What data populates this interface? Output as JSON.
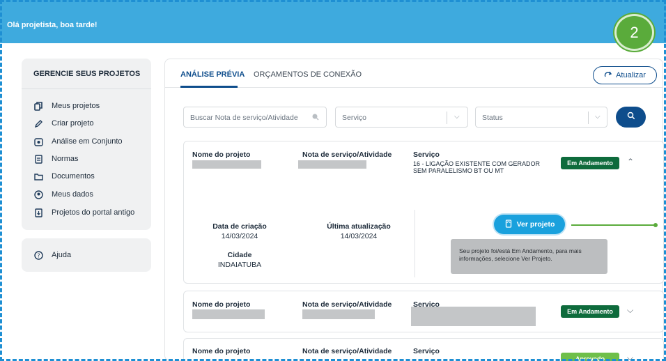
{
  "header": {
    "greeting": "Olá projetista, boa tarde!",
    "step_number": "2"
  },
  "sidebar": {
    "title": "GERENCIE SEUS PROJETOS",
    "items": [
      {
        "label": "Meus projetos",
        "icon": "copy-icon"
      },
      {
        "label": "Criar projeto",
        "icon": "pencil-icon"
      },
      {
        "label": "Análise em Conjunto",
        "icon": "shared-docs-icon"
      },
      {
        "label": "Normas",
        "icon": "document-icon"
      },
      {
        "label": "Documentos",
        "icon": "folder-icon"
      },
      {
        "label": "Meus dados",
        "icon": "user-icon"
      },
      {
        "label": "Projetos do portal antigo",
        "icon": "archive-icon"
      }
    ],
    "help": {
      "label": "Ajuda",
      "icon": "question-icon"
    }
  },
  "tabs": [
    {
      "label": "ANÁLISE PRÉVIA",
      "active": true
    },
    {
      "label": "ORÇAMENTOS DE CONEXÃO",
      "active": false
    }
  ],
  "refresh_label": "Atualizar",
  "filters": {
    "search_placeholder": "Buscar Nota de serviço/Atividade",
    "service_placeholder": "Serviço",
    "status_placeholder": "Status"
  },
  "columns": {
    "project_name": "Nome do projeto",
    "service_note": "Nota de serviço/Atividade",
    "service": "Serviço"
  },
  "projects": [
    {
      "service_text": "16 - LIGAÇÃO EXISTENTE COM GERADOR SEM PARALELISMO BT OU MT",
      "status": "Em Andamento",
      "expanded": true,
      "details": {
        "created_label": "Data de criação",
        "created_value": "14/03/2024",
        "updated_label": "Última atualização",
        "updated_value": "14/03/2024",
        "city_label": "Cidade",
        "city_value": "INDAIATUBA",
        "view_button": "Ver projeto",
        "tooltip": "Seu projeto foi/está Em Andamento, para mais informações, selecione Ver Projeto."
      }
    },
    {
      "status": "Em Andamento",
      "expanded": false
    },
    {
      "status": "Aprovado",
      "expanded": false
    }
  ],
  "colors": {
    "header": "#3eaade",
    "primary": "#0e4d8c",
    "accent": "#1aa1dd",
    "status_green": "#0e6b3c",
    "callout": "#5aab3b"
  }
}
